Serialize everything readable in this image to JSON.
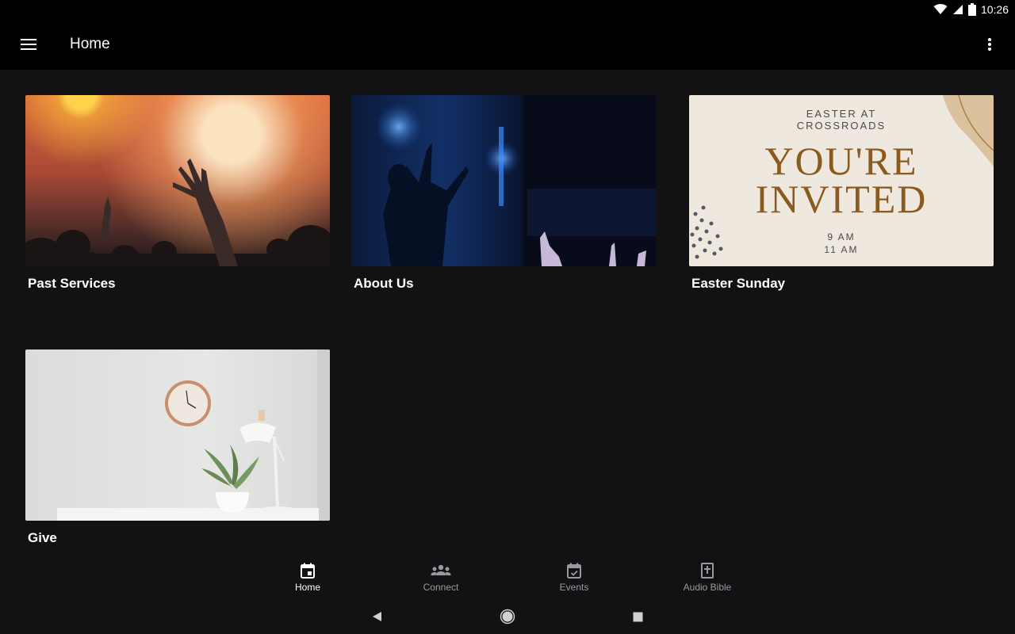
{
  "status_bar": {
    "time": "10:26"
  },
  "app_bar": {
    "title": "Home"
  },
  "cards": [
    {
      "label": "Past Services"
    },
    {
      "label": "About Us"
    },
    {
      "label": "Easter Sunday",
      "image_text": {
        "line1": "EASTER AT",
        "line2": "CROSSROADS",
        "headline1": "YOU'RE",
        "headline2": "INVITED",
        "time1": "9 AM",
        "time2": "11 AM"
      }
    },
    {
      "label": "Give"
    }
  ],
  "bottom_nav": [
    {
      "label": "Home",
      "icon": "calendar-icon",
      "active": true
    },
    {
      "label": "Connect",
      "icon": "group-icon",
      "active": false
    },
    {
      "label": "Events",
      "icon": "event-check-icon",
      "active": false
    },
    {
      "label": "Audio Bible",
      "icon": "bible-icon",
      "active": false
    }
  ],
  "colors": {
    "background": "#121214",
    "bar": "#000000",
    "nav_active": "#ffffff",
    "nav_inactive": "#9a9a9e",
    "easter_gold": "#8a5a1f"
  }
}
